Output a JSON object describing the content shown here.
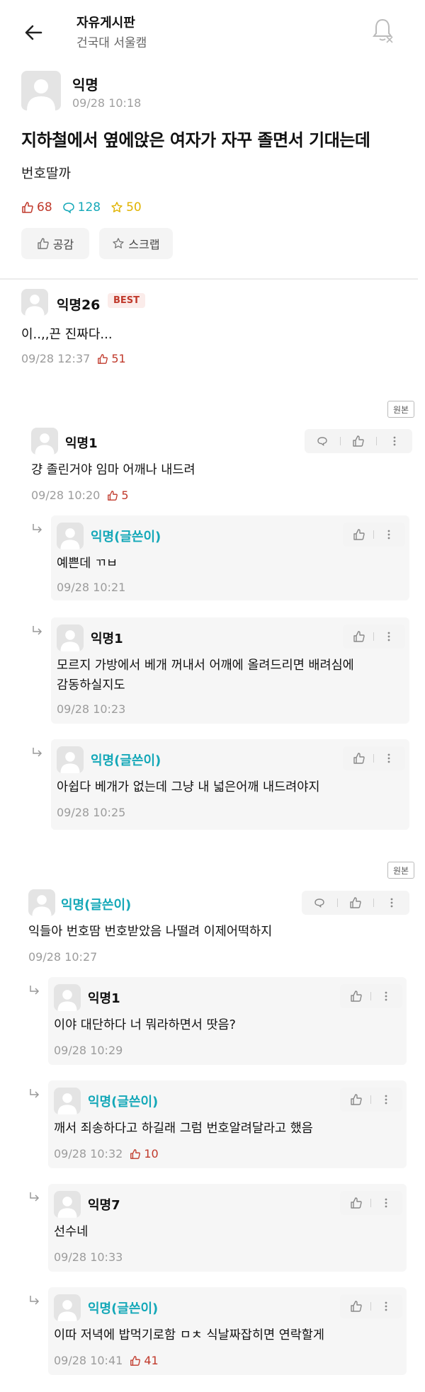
{
  "header": {
    "title": "자유게시판",
    "subtitle": "건국대 서울캠"
  },
  "post": {
    "author": "익명",
    "time": "09/28 10:18",
    "title": "지하철에서 옆에앉은 여자가 자꾸 졸면서 기대는데",
    "body": "번호딸까",
    "likes": "68",
    "comments": "128",
    "scraps": "50",
    "empathy_label": "공감",
    "scrap_label": "스크랩"
  },
  "best": {
    "author": "익명26",
    "badge": "BEST",
    "text": "이..,,끈 진짜다...",
    "time": "09/28 12:37",
    "likes": "51"
  },
  "origin_label": "원본",
  "thread1": {
    "author": "익명1",
    "text": "걍 졸린거야 임마 어깨나 내드려",
    "time": "09/28 10:20",
    "likes": "5",
    "replies": [
      {
        "author": "익명(글쓴이)",
        "text": "예쁜데 ㄲㅂ",
        "time": "09/28 10:21"
      },
      {
        "author": "익명1",
        "text_line1": "모르지 가방에서 베개 꺼내서 어깨에 올려드리면 배려심에",
        "text_line2": "감동하실지도",
        "time": "09/28 10:23"
      },
      {
        "author": "익명(글쓴이)",
        "text": "아쉽다 베개가 없는데 그냥 내 넓은어깨 내드려야지",
        "time": "09/28 10:25"
      }
    ]
  },
  "thread2": {
    "author": "익명(글쓴이)",
    "text": "익들아 번호땀 번호받았음 나떨려 이제어떡하지",
    "time": "09/28 10:27",
    "replies": [
      {
        "author": "익명1",
        "text": "이야 대단하다 너 뭐라하면서 땃음?",
        "time": "09/28 10:29"
      },
      {
        "author": "익명(글쓴이)",
        "text": "깨서 죄송하다고 하길래 그럼 번호알려달라고 했음",
        "time": "09/28 10:32",
        "likes": "10"
      },
      {
        "author": "익명7",
        "text": "선수네",
        "time": "09/28 10:33"
      },
      {
        "author": "익명(글쓴이)",
        "text": "이따 저녁에 밥먹기로함 ㅁㅊ 식날짜잡히면 연락할게",
        "time": "09/28 10:41",
        "likes": "41"
      }
    ]
  },
  "colors": {
    "like": "#c0392b",
    "comment": "#14a8b8",
    "scrap": "#e0b300",
    "writer": "#14a8b8"
  },
  "icons": [
    "back-arrow-icon",
    "bell-off-icon",
    "thumbs-up-icon",
    "comment-icon",
    "star-icon",
    "more-vertical-icon",
    "reply-arrow-icon"
  ]
}
